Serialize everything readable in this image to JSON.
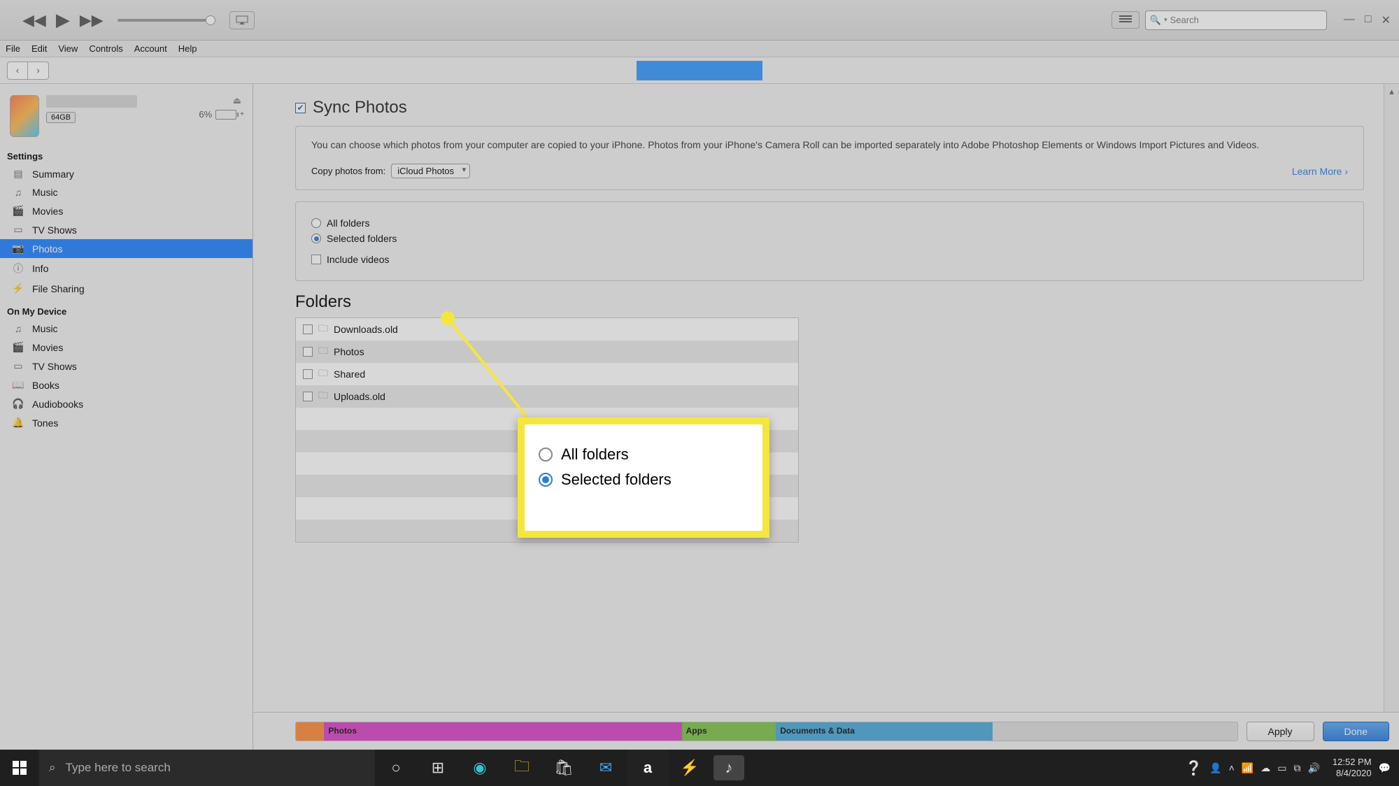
{
  "top": {
    "search_placeholder": "Search"
  },
  "window_controls": {
    "min": "—",
    "max": "□",
    "close": "✕"
  },
  "menu": [
    "File",
    "Edit",
    "View",
    "Controls",
    "Account",
    "Help"
  ],
  "device": {
    "storage": "64GB",
    "battery_pct": "6%"
  },
  "sidebar": {
    "settings_label": "Settings",
    "settings_items": [
      {
        "icon": "▤",
        "label": "Summary"
      },
      {
        "icon": "♫",
        "label": "Music"
      },
      {
        "icon": "🎬",
        "label": "Movies"
      },
      {
        "icon": "▭",
        "label": "TV Shows"
      },
      {
        "icon": "📷",
        "label": "Photos",
        "selected": true
      },
      {
        "icon": "ⓘ",
        "label": "Info"
      },
      {
        "icon": "⚡",
        "label": "File Sharing"
      }
    ],
    "device_label": "On My Device",
    "device_items": [
      {
        "icon": "♫",
        "label": "Music"
      },
      {
        "icon": "🎬",
        "label": "Movies"
      },
      {
        "icon": "▭",
        "label": "TV Shows"
      },
      {
        "icon": "📖",
        "label": "Books"
      },
      {
        "icon": "🎧",
        "label": "Audiobooks"
      },
      {
        "icon": "🔔",
        "label": "Tones"
      }
    ]
  },
  "content": {
    "sync_title": "Sync Photos",
    "description": "You can choose which photos from your computer are copied to your iPhone. Photos from your iPhone's Camera Roll can be imported separately into Adobe Photoshop Elements or Windows Import Pictures and Videos.",
    "copy_label": "Copy photos from:",
    "copy_source": "iCloud Photos",
    "learn_more": "Learn More",
    "radio_all": "All folders",
    "radio_selected": "Selected folders",
    "include_videos": "Include videos",
    "folders_title": "Folders",
    "folders": [
      "Downloads.old",
      "Photos",
      "Shared",
      "Uploads.old"
    ]
  },
  "storage_bar": {
    "photos": "Photos",
    "apps": "Apps",
    "docs": "Documents & Data"
  },
  "buttons": {
    "apply": "Apply",
    "done": "Done"
  },
  "taskbar": {
    "search_placeholder": "Type here to search",
    "time": "12:52 PM",
    "date": "8/4/2020"
  },
  "callout": {
    "opt1": "All folders",
    "opt2": "Selected folders"
  }
}
